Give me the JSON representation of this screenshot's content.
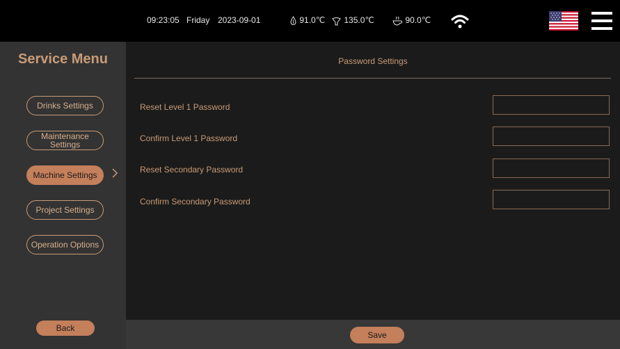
{
  "status_bar": {
    "time": "09:23:05",
    "day": "Friday",
    "date": "2023-09-01",
    "temp_water": "91.0℃",
    "temp_steam": "135.0℃",
    "temp_coffee": "90.0℃",
    "icons": [
      "water-drop-icon",
      "steam-icon",
      "coffee-cup-icon",
      "wifi-icon",
      "us-flag-icon",
      "hamburger-menu-icon"
    ]
  },
  "sidebar": {
    "title": "Service Menu",
    "items": [
      {
        "label": "Drinks Settings"
      },
      {
        "label": "Maintenance Settings"
      },
      {
        "label": "Machine Settings",
        "active": true
      },
      {
        "label": "Project Settings"
      },
      {
        "label": "Operation Options"
      }
    ],
    "back_label": "Back"
  },
  "main": {
    "title": "Password Settings",
    "rows": [
      {
        "label": "Reset Level 1 Password",
        "value": ""
      },
      {
        "label": "Confirm Level 1 Password",
        "value": ""
      },
      {
        "label": "Reset Secondary Password",
        "value": ""
      },
      {
        "label": "Confirm Secondary Password",
        "value": ""
      }
    ],
    "save_label": "Save"
  },
  "colors": {
    "accent": "#c99b77",
    "button_fill": "#c47f5b",
    "sidebar_bg": "#333333",
    "main_bg": "#1b1b1b",
    "topbar_bg": "#000000"
  }
}
